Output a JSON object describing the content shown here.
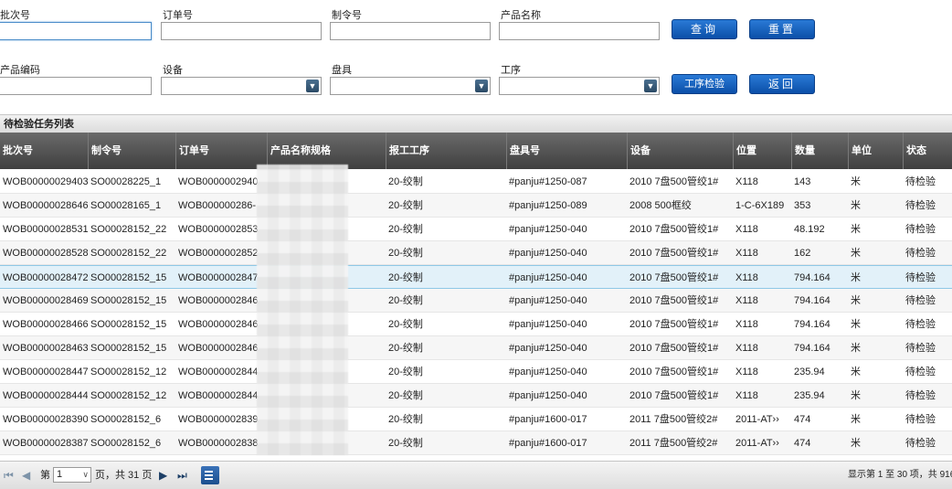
{
  "filters": {
    "batch_label": "批次号",
    "order_label": "订单号",
    "make_order_label": "制令号",
    "product_name_label": "产品名称",
    "product_code_label": "产品编码",
    "equipment_label": "设备",
    "reel_label": "盘具",
    "process_label": "工序",
    "query_button": "查询",
    "reset_button": "重置",
    "process_check_button": "工序检验",
    "back_button": "返回"
  },
  "grid": {
    "title": "待检验任务列表",
    "columns": [
      "批次号",
      "制令号",
      "订单号",
      "产品名称规格",
      "报工工序",
      "盘具号",
      "设备",
      "位置",
      "数量",
      "单位",
      "状态"
    ],
    "rows": [
      [
        "WOB00000029403",
        "SO00028225_1",
        "WOB0000002940",
        "",
        "20-绞制",
        "#panju#1250-087",
        "2010 7盘500管绞1#",
        "X118",
        "143",
        "米",
        "待检验"
      ],
      [
        "WOB00000028646",
        "SO00028165_1",
        "WOB000000286-",
        "",
        "20-绞制",
        "#panju#1250-089",
        "2008 500框绞",
        "1-C-6X189",
        "353",
        "米",
        "待检验"
      ],
      [
        "WOB00000028531",
        "SO00028152_22",
        "WOB0000002853",
        "",
        "20-绞制",
        "#panju#1250-040",
        "2010 7盘500管绞1#",
        "X118",
        "48.192",
        "米",
        "待检验"
      ],
      [
        "WOB00000028528",
        "SO00028152_22",
        "WOB0000002852",
        "",
        "20-绞制",
        "#panju#1250-040",
        "2010 7盘500管绞1#",
        "X118",
        "162",
        "米",
        "待检验"
      ],
      [
        "WOB00000028472",
        "SO00028152_15",
        "WOB0000002847",
        "",
        "20-绞制",
        "#panju#1250-040",
        "2010 7盘500管绞1#",
        "X118",
        "794.164",
        "米",
        "待检验"
      ],
      [
        "WOB00000028469",
        "SO00028152_15",
        "WOB0000002846",
        "",
        "20-绞制",
        "#panju#1250-040",
        "2010 7盘500管绞1#",
        "X118",
        "794.164",
        "米",
        "待检验"
      ],
      [
        "WOB00000028466",
        "SO00028152_15",
        "WOB0000002846",
        "",
        "20-绞制",
        "#panju#1250-040",
        "2010 7盘500管绞1#",
        "X118",
        "794.164",
        "米",
        "待检验"
      ],
      [
        "WOB00000028463",
        "SO00028152_15",
        "WOB0000002846",
        "",
        "20-绞制",
        "#panju#1250-040",
        "2010 7盘500管绞1#",
        "X118",
        "794.164",
        "米",
        "待检验"
      ],
      [
        "WOB00000028447",
        "SO00028152_12",
        "WOB0000002844",
        "",
        "20-绞制",
        "#panju#1250-040",
        "2010 7盘500管绞1#",
        "X118",
        "235.94",
        "米",
        "待检验"
      ],
      [
        "WOB00000028444",
        "SO00028152_12",
        "WOB0000002844",
        "",
        "20-绞制",
        "#panju#1250-040",
        "2010 7盘500管绞1#",
        "X118",
        "235.94",
        "米",
        "待检验"
      ],
      [
        "WOB00000028390",
        "SO00028152_6",
        "WOB0000002839",
        "",
        "20-绞制",
        "#panju#1600-017",
        "2011 7盘500管绞2#",
        "2011-AT››",
        "474",
        "米",
        "待检验"
      ],
      [
        "WOB00000028387",
        "SO00028152_6",
        "WOB0000002838",
        "",
        "20-绞制",
        "#panju#1600-017",
        "2011 7盘500管绞2#",
        "2011-AT››",
        "474",
        "米",
        "待检验"
      ]
    ],
    "selected_row": 4
  },
  "pager": {
    "page_prefix": "第",
    "page_value": "1",
    "page_suffix": "页，共 31 页",
    "summary": "显示第 1 至 30 项，共 916"
  },
  "colors": {
    "button": "#1560bd",
    "header": "#4f4f4f",
    "selected_row": "#e2f1f9"
  }
}
